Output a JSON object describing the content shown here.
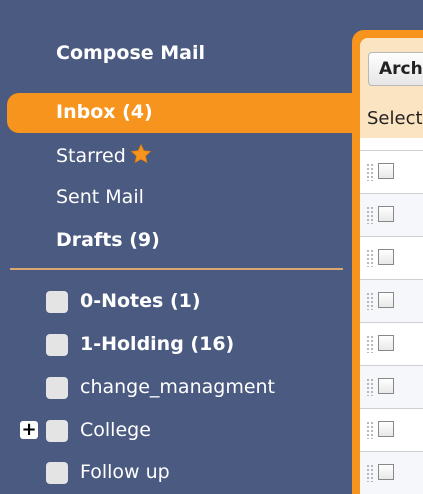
{
  "sidebar": {
    "compose_label": "Compose Mail",
    "nav": {
      "inbox": "Inbox (4)",
      "starred": "Starred",
      "sent": "Sent Mail",
      "drafts": "Drafts (9)"
    },
    "labels": [
      {
        "text": "0-Notes (1)"
      },
      {
        "text": "1-Holding (16)"
      },
      {
        "text": "change_managment"
      },
      {
        "text": "College"
      },
      {
        "text": "Follow up"
      }
    ],
    "colors": {
      "sidebar_bg": "#4a5a80",
      "accent": "#f7941d",
      "star": "#f7941d"
    }
  },
  "main": {
    "archive_label": "Archive",
    "select_label": "Select:"
  }
}
